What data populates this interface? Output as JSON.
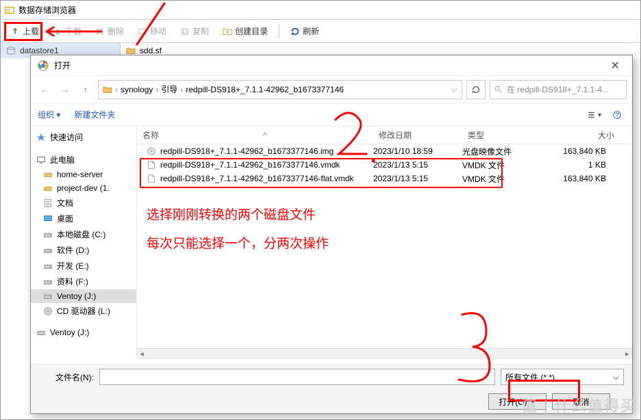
{
  "host": {
    "title": "数据存储浏览器",
    "toolbar": {
      "upload": "上载",
      "download": "下载",
      "delete": "删除",
      "move": "移动",
      "copy": "复制",
      "mkdir": "创建目录",
      "refresh": "刷新"
    },
    "tree": {
      "root": "datastore1",
      "items": [
        "sdd.sf"
      ]
    }
  },
  "dialog": {
    "title": "打开",
    "breadcrumbs": [
      "synology",
      "引导",
      "redpill-DS918+_7.1.1-42962_b1673377146"
    ],
    "search_placeholder": "在 redpill-DS918+_7.1.1-4...",
    "toolbar": {
      "organize": "组织",
      "new_folder": "新建文件夹"
    },
    "columns": {
      "name": "名称",
      "date": "修改日期",
      "type": "类型",
      "size": "大小"
    },
    "files": [
      {
        "name": "redpill-DS918+_7.1.1-42962_b1673377146.img",
        "date": "2023/1/10 18:59",
        "type": "光盘映像文件",
        "size": "163,840 KB",
        "icon": "disc"
      },
      {
        "name": "redpill-DS918+_7.1.1-42962_b1673377146.vmdk",
        "date": "2023/1/13 5:15",
        "type": "VMDK 文件",
        "size": "1 KB",
        "icon": "file"
      },
      {
        "name": "redpill-DS918+_7.1.1-42962_b1673377146-flat.vmdk",
        "date": "2023/1/13 5:15",
        "type": "VMDK 文件",
        "size": "163,840 KB",
        "icon": "file"
      }
    ],
    "sidebar": {
      "quick": "快速访问",
      "pc": "此电脑",
      "items": [
        {
          "label": "home-server",
          "icon": "drive-y"
        },
        {
          "label": "project-dev (1.",
          "icon": "drive-y"
        },
        {
          "label": "文档",
          "icon": "doc"
        },
        {
          "label": "桌面",
          "icon": "desktop"
        },
        {
          "label": "本地磁盘 (C:)",
          "icon": "disk"
        },
        {
          "label": "软件 (D:)",
          "icon": "disk"
        },
        {
          "label": "开发 (E:)",
          "icon": "disk"
        },
        {
          "label": "资料 (F:)",
          "icon": "disk"
        },
        {
          "label": "Ventoy (J:)",
          "icon": "disk",
          "selected": true
        },
        {
          "label": "CD 驱动器 (L:)",
          "icon": "cd"
        }
      ],
      "extra": "Ventoy (J:)"
    },
    "footer": {
      "filename_label": "文件名(N):",
      "filter": "所有文件 (*.*)",
      "open": "打开(O)",
      "cancel": "取消"
    }
  },
  "annotations": {
    "line1": "选择刚刚转换的两个磁盘文件",
    "line2": "每次只能选择一个，分两次操作"
  },
  "watermark": "值 | 什么值得买"
}
